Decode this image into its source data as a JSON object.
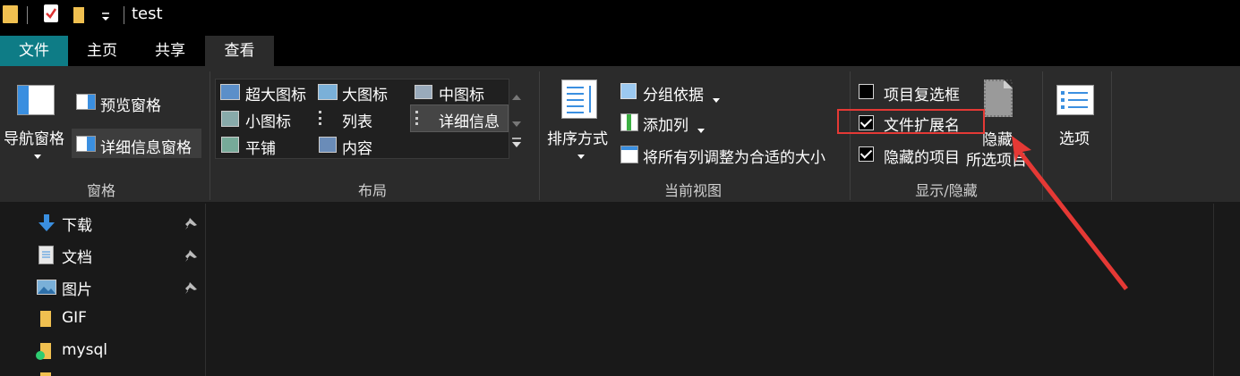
{
  "window": {
    "title": "test"
  },
  "tabs": [
    {
      "label": "文件",
      "active_color": "#0e7c86"
    },
    {
      "label": "主页"
    },
    {
      "label": "共享"
    },
    {
      "label": "查看"
    }
  ],
  "panes_group": {
    "label": "窗格",
    "nav_pane": "导航窗格",
    "preview_pane": "预览窗格",
    "details_pane": "详细信息窗格"
  },
  "layout_group": {
    "label": "布局",
    "items": [
      "超大图标",
      "大图标",
      "中图标",
      "小图标",
      "列表",
      "详细信息",
      "平铺",
      "内容"
    ]
  },
  "current_view_group": {
    "label": "当前视图",
    "sort_by": "排序方式",
    "group_by": "分组依据",
    "add_column": "添加列",
    "size_all_columns": "将所有列调整为合适的大小"
  },
  "show_hide_group": {
    "label": "显示/隐藏",
    "item_checkboxes": {
      "label": "项目复选框",
      "checked": false
    },
    "file_name_extensions": {
      "label": "文件扩展名",
      "checked": true
    },
    "hidden_items": {
      "label": "隐藏的项目",
      "checked": true
    },
    "hide_selected_line1": "隐藏",
    "hide_selected_line2": "所选项目"
  },
  "options": {
    "label": "选项"
  },
  "nav_items": [
    {
      "label": "下载",
      "icon": "download-arrow-icon",
      "pinned": true
    },
    {
      "label": "文档",
      "icon": "document-icon",
      "pinned": true
    },
    {
      "label": "图片",
      "icon": "picture-icon",
      "pinned": true
    },
    {
      "label": "GIF",
      "icon": "folder-icon",
      "pinned": false
    },
    {
      "label": "mysql",
      "icon": "folder-synced-icon",
      "pinned": false
    }
  ],
  "annotation": {
    "color": "#e53935"
  }
}
